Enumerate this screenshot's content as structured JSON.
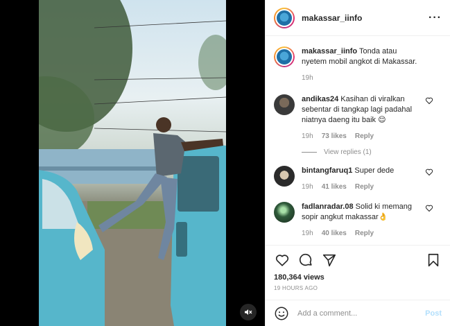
{
  "post": {
    "username": "makassar_iinfo",
    "more_icon": "more-horizontal-icon"
  },
  "caption": {
    "username": "makassar_iinfo",
    "text": "Tonda atau nyetem mobil angkot di Makassar.",
    "time": "19h"
  },
  "comments": [
    {
      "username": "andikas24",
      "text": "Kasihan di viralkan sebentar di tangkap lagi padahal niatnya daeng itu baik 😌",
      "time": "19h",
      "likes": "73 likes",
      "reply": "Reply",
      "view_replies": "View replies (1)"
    },
    {
      "username": "bintangfaruq1",
      "text": "Super dede",
      "time": "19h",
      "likes": "41 likes",
      "reply": "Reply"
    },
    {
      "username": "fadlanradar.08",
      "text": "Solid ki memang sopir angkut makassar👌",
      "time": "19h",
      "likes": "40 likes",
      "reply": "Reply"
    }
  ],
  "stats": {
    "views": "180,364 views",
    "timestamp": "19 HOURS AGO"
  },
  "comment_box": {
    "placeholder": "Add a comment...",
    "post_label": "Post"
  },
  "colors": {
    "accent": "#0095f6",
    "post_disabled": "#b2dffc",
    "angkot_blue": "#4fb3c9",
    "muted_text": "#8e8e8e"
  }
}
